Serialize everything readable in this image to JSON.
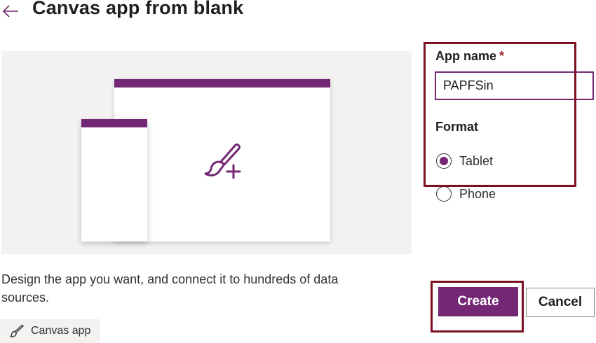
{
  "header": {
    "title": "Canvas app from blank"
  },
  "description": "Design the app you want, and connect it to hundreds of data sources.",
  "tag": {
    "label": "Canvas app",
    "icon": "paintbrush-icon"
  },
  "form": {
    "app_name_label": "App name",
    "required_marker": "*",
    "app_name_value": "PAPFSin",
    "format_label": "Format",
    "options": [
      {
        "label": "Tablet",
        "selected": true
      },
      {
        "label": "Phone",
        "selected": false
      }
    ]
  },
  "buttons": {
    "create": "Create",
    "cancel": "Cancel"
  },
  "colors": {
    "accent": "#742774",
    "highlight_border": "#7a1021",
    "preview_bg": "#f3f2f1"
  }
}
